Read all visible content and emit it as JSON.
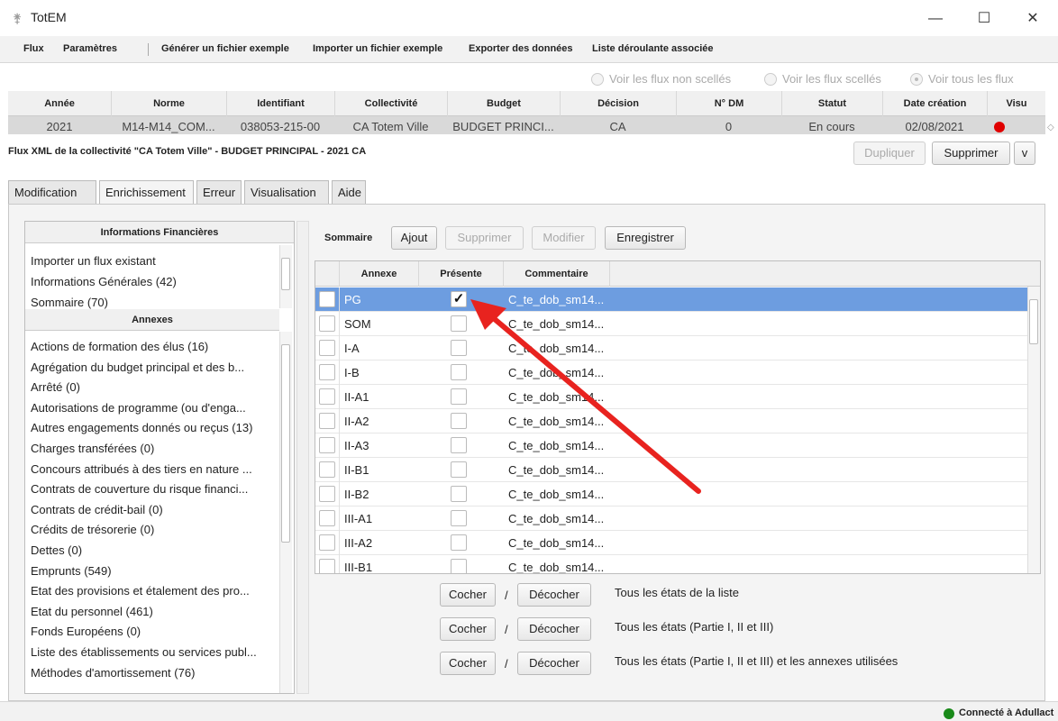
{
  "window": {
    "title": "TotEM",
    "minimize": "—",
    "maximize": "☐",
    "close": "✕"
  },
  "menu": [
    "Flux",
    "Paramètres",
    "Générer un fichier exemple",
    "Importer un fichier exemple",
    "Exporter des données",
    "Liste déroulante associée"
  ],
  "filters": {
    "options": [
      "Voir les flux non scellés",
      "Voir les flux scellés",
      "Voir tous les flux"
    ],
    "selected": "Voir tous les flux"
  },
  "flux_table": {
    "columns": [
      "Année",
      "Norme",
      "Identifiant",
      "Collectivité",
      "Budget",
      "Décision",
      "N° DM",
      "Statut",
      "Date création",
      "Visu"
    ],
    "row": [
      "2021",
      "M14-M14_COM...",
      "038053-215-00",
      "CA Totem Ville",
      "BUDGET PRINCI...",
      "CA",
      "0",
      "En cours",
      "02/08/2021",
      ""
    ],
    "visu_color": "#e00000"
  },
  "info": {
    "line": "Flux XML de la collectivité \"CA Totem Ville\" - BUDGET PRINCIPAL - 2021 CA",
    "duplicate": "Dupliquer",
    "delete": "Supprimer",
    "v": "v"
  },
  "tabs": {
    "items": [
      "Modification",
      "Enrichissement",
      "Erreur",
      "Visualisation",
      "Aide"
    ],
    "active": "Enrichissement"
  },
  "left": {
    "fin_header": "Informations Financières",
    "fin_items": [
      "Importer un flux existant",
      "Informations Générales (42)",
      "Sommaire (70)"
    ],
    "annex_header": "Annexes",
    "annex_items": [
      "Actions de formation des élus (16)",
      "Agrégation du budget principal et des b...",
      "Arrêté (0)",
      "Autorisations de programme (ou d'enga...",
      "Autres engagements donnés ou reçus (13)",
      "Charges transférées (0)",
      "Concours attribués à des tiers en nature ...",
      "Contrats de couverture du risque financi...",
      "Contrats de crédit-bail (0)",
      "Crédits de trésorerie (0)",
      "Dettes (0)",
      "Emprunts (549)",
      "Etat des provisions et étalement des pro...",
      "Etat du personnel (461)",
      "Fonds Européens (0)",
      "Liste des établissements ou services publ...",
      "Méthodes d'amortissement (76)"
    ]
  },
  "right": {
    "section": "Sommaire",
    "add": "Ajout",
    "remove": "Supprimer",
    "edit": "Modifier",
    "save": "Enregistrer",
    "columns": [
      "Annexe",
      "Présente",
      "Commentaire"
    ],
    "rows": [
      {
        "annexe": "PG",
        "present": true,
        "comment": "C_te_dob_sm14..."
      },
      {
        "annexe": "SOM",
        "present": false,
        "comment": "C_te_dob_sm14..."
      },
      {
        "annexe": "I-A",
        "present": false,
        "comment": "C_te_dob_sm14..."
      },
      {
        "annexe": "I-B",
        "present": false,
        "comment": "C_te_dob_sm14..."
      },
      {
        "annexe": "II-A1",
        "present": false,
        "comment": "C_te_dob_sm14..."
      },
      {
        "annexe": "II-A2",
        "present": false,
        "comment": "C_te_dob_sm14..."
      },
      {
        "annexe": "II-A3",
        "present": false,
        "comment": "C_te_dob_sm14..."
      },
      {
        "annexe": "II-B1",
        "present": false,
        "comment": "C_te_dob_sm14..."
      },
      {
        "annexe": "II-B2",
        "present": false,
        "comment": "C_te_dob_sm14..."
      },
      {
        "annexe": "III-A1",
        "present": false,
        "comment": "C_te_dob_sm14..."
      },
      {
        "annexe": "III-A2",
        "present": false,
        "comment": "C_te_dob_sm14..."
      },
      {
        "annexe": "III-B1",
        "present": false,
        "comment": "C_te_dob_sm14..."
      }
    ],
    "bulk": [
      {
        "check": "Cocher",
        "sep": "/",
        "uncheck": "Décocher",
        "desc": "Tous les états de la liste"
      },
      {
        "check": "Cocher",
        "sep": "/",
        "uncheck": "Décocher",
        "desc": "Tous les états (Partie I, II et III)"
      },
      {
        "check": "Cocher",
        "sep": "/",
        "uncheck": "Décocher",
        "desc": "Tous les états (Partie I, II et III) et les annexes utilisées"
      }
    ]
  },
  "status": {
    "text": "Connecté à Adullact",
    "color": "#1a8a1a"
  },
  "annotation": {
    "arrow_color": "#e8231f"
  }
}
